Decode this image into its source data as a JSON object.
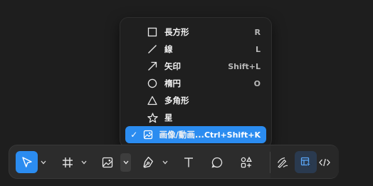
{
  "menu": {
    "items": [
      {
        "label": "長方形",
        "shortcut": "R",
        "icon": "rectangle-icon",
        "selected": false
      },
      {
        "label": "線",
        "shortcut": "L",
        "icon": "line-icon",
        "selected": false
      },
      {
        "label": "矢印",
        "shortcut": "Shift+L",
        "icon": "arrow-icon",
        "selected": false
      },
      {
        "label": "楕円",
        "shortcut": "O",
        "icon": "ellipse-icon",
        "selected": false
      },
      {
        "label": "多角形",
        "shortcut": "",
        "icon": "polygon-icon",
        "selected": false
      },
      {
        "label": "星",
        "shortcut": "",
        "icon": "star-icon",
        "selected": false
      },
      {
        "label": "画像/動画...",
        "shortcut": "Ctrl+Shift+K",
        "icon": "image-icon",
        "selected": true,
        "check": "✓"
      }
    ]
  },
  "toolbar": {
    "tools": [
      "move-tool",
      "frame-tool",
      "image-tool",
      "pen-tool",
      "text-tool",
      "comment-tool",
      "actions-tool"
    ],
    "active_tool": "move-tool",
    "right_tools": [
      "draw-mode",
      "design-mode",
      "dev-mode"
    ],
    "active_mode": "design-mode"
  },
  "colors": {
    "accent": "#2b8cf0",
    "background": "#1e1e1e",
    "menu_bg": "#1f1f1f",
    "toolbar_bg": "#2c2c2c"
  }
}
